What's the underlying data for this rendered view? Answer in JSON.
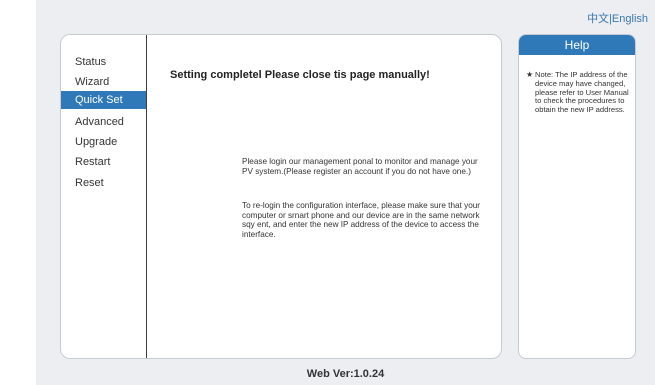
{
  "lang": {
    "chinese": "中文",
    "separator": "|",
    "english": "English"
  },
  "menu": [
    {
      "label": "Status"
    },
    {
      "label": "Wizard"
    },
    {
      "label": "Quick Set",
      "active": true
    },
    {
      "label": "Advanced"
    },
    {
      "label": "Upgrade"
    },
    {
      "label": "Restart"
    },
    {
      "label": "Reset"
    }
  ],
  "main": {
    "title": "Setting completel Please close tis page manually!",
    "paragraph1": "Please login our management ponal to monitor and manage your PV system.(Please register an account if you do not have one.)",
    "paragraph2": "To re-login the configuration interface, please make sure that your computer or srnart phone and our device are in the same network sqy ent, and enter the new IP address of the device to access the interface."
  },
  "help": {
    "title": "Help",
    "bullet": "★",
    "note": "Note: The IP address of the device may have changed, please refer to User Manual to check the procedures to obtain the new IP address."
  },
  "footer": {
    "version": "Web Ver:1.0.24"
  },
  "colors": {
    "accent": "#2f79b9",
    "background": "#eceef1",
    "link": "#3a78ad"
  }
}
